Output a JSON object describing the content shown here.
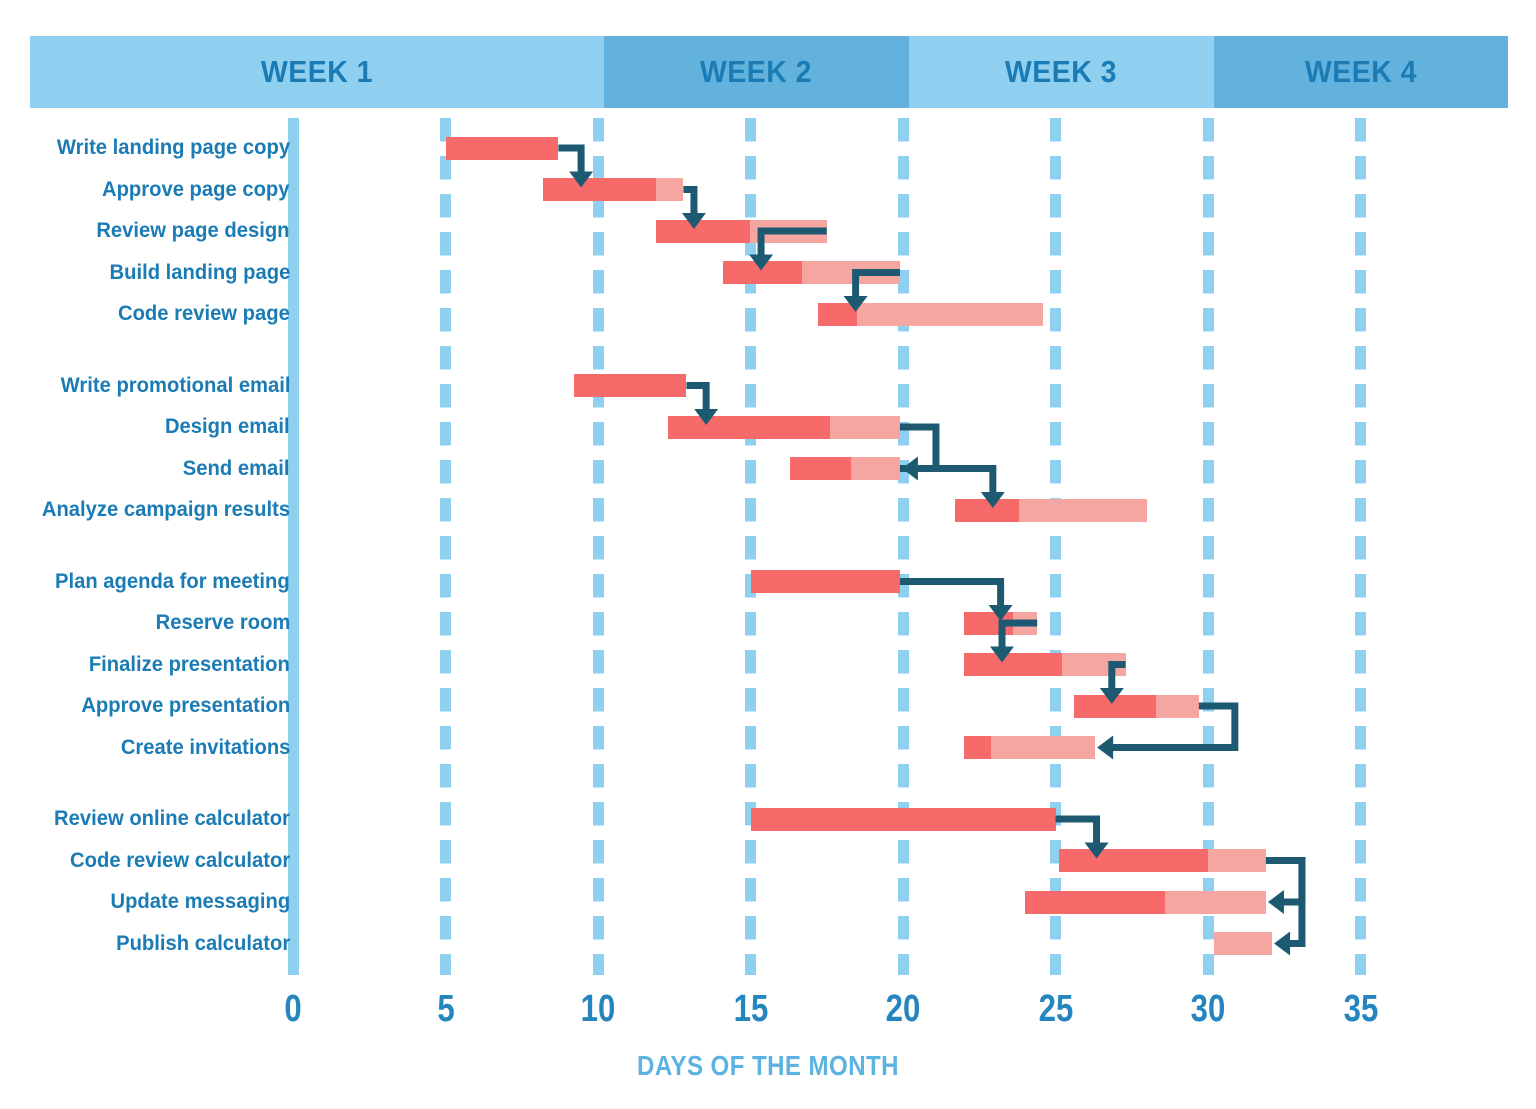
{
  "chart_data": {
    "type": "bar",
    "subtype": "gantt",
    "title": "",
    "xlabel": "DAYS OF THE MONTH",
    "ylabel": "",
    "xlim": [
      0,
      36.5
    ],
    "xticks": [
      0,
      5,
      10,
      15,
      20,
      25,
      30,
      35
    ],
    "xtick_labels": [
      "0",
      "5",
      "10",
      "15",
      "20",
      "25",
      "30",
      "35"
    ],
    "grid": true,
    "legend": "none",
    "colors": {
      "bar_dark": "#f76a6a",
      "bar_light": "#f6a6a1",
      "connector": "#1d5a72",
      "grid": "#8fd0f0",
      "week_light": "#8fd0f0",
      "week_dark": "#63b2de",
      "label_text": "#1b7cb5",
      "tick_text": "#2585bf",
      "axis_title": "#5cb3e0"
    },
    "weeks": [
      {
        "label": "WEEK 1",
        "start": 0,
        "end": 10,
        "shade": "light"
      },
      {
        "label": "WEEK 2",
        "start": 10,
        "end": 20,
        "shade": "dark"
      },
      {
        "label": "WEEK 3",
        "start": 20,
        "end": 30,
        "shade": "light"
      },
      {
        "label": "WEEK 4",
        "start": 30,
        "end": 40,
        "shade": "dark"
      }
    ],
    "groups": [
      {
        "name": "landing-page",
        "tasks": [
          {
            "label": "Write landing page copy",
            "start": 5.0,
            "dark_end": 8.7,
            "end": 8.7
          },
          {
            "label": "Approve page copy",
            "start": 8.2,
            "dark_end": 11.9,
            "end": 12.8
          },
          {
            "label": "Review page design",
            "start": 11.9,
            "dark_end": 15.0,
            "end": 17.5
          },
          {
            "label": "Build landing page",
            "start": 14.1,
            "dark_end": 16.7,
            "end": 19.9
          },
          {
            "label": "Code review page",
            "start": 17.2,
            "dark_end": 18.5,
            "end": 24.6
          }
        ]
      },
      {
        "name": "email-campaign",
        "tasks": [
          {
            "label": "Write promotional email",
            "start": 9.2,
            "dark_end": 12.9,
            "end": 12.9
          },
          {
            "label": "Design email",
            "start": 12.3,
            "dark_end": 17.6,
            "end": 19.9
          },
          {
            "label": "Send email",
            "start": 16.3,
            "dark_end": 18.3,
            "end": 19.9
          },
          {
            "label": "Analyze campaign results",
            "start": 21.7,
            "dark_end": 23.8,
            "end": 28.0
          }
        ]
      },
      {
        "name": "meeting",
        "tasks": [
          {
            "label": "Plan agenda for meeting",
            "start": 15.0,
            "dark_end": 19.9,
            "end": 19.9
          },
          {
            "label": "Reserve room",
            "start": 22.0,
            "dark_end": 23.6,
            "end": 24.4
          },
          {
            "label": "Finalize presentation",
            "start": 22.0,
            "dark_end": 25.2,
            "end": 27.3
          },
          {
            "label": "Approve presentation",
            "start": 25.6,
            "dark_end": 28.3,
            "end": 29.7
          },
          {
            "label": "Create invitations",
            "start": 22.0,
            "dark_end": 22.9,
            "end": 26.3
          }
        ]
      },
      {
        "name": "calculator",
        "tasks": [
          {
            "label": "Review online calculator",
            "start": 15.0,
            "dark_end": 25.0,
            "end": 25.0
          },
          {
            "label": "Code review calculator",
            "start": 25.1,
            "dark_end": 30.0,
            "end": 31.9
          },
          {
            "label": "Update messaging",
            "start": 24.0,
            "dark_end": 28.6,
            "end": 31.9
          },
          {
            "label": "Publish calculator",
            "start": 30.2,
            "dark_end": 30.2,
            "end": 32.1
          }
        ]
      }
    ],
    "dependencies": [
      {
        "from": "Write landing page copy",
        "to": "Approve page copy",
        "direction": "down"
      },
      {
        "from": "Approve page copy",
        "to": "Review page design",
        "direction": "down"
      },
      {
        "from": "Review page design",
        "to": "Build landing page",
        "direction": "down"
      },
      {
        "from": "Build landing page",
        "to": "Code review page",
        "direction": "down"
      },
      {
        "from": "Write promotional email",
        "to": "Design email",
        "direction": "down"
      },
      {
        "from": "Design email",
        "to": "Send email",
        "direction": "left"
      },
      {
        "from": "Send email",
        "to": "Analyze campaign results",
        "direction": "down"
      },
      {
        "from": "Plan agenda for meeting",
        "to": "Reserve room",
        "direction": "down"
      },
      {
        "from": "Reserve room",
        "to": "Finalize presentation",
        "direction": "down"
      },
      {
        "from": "Finalize presentation",
        "to": "Approve presentation",
        "direction": "down"
      },
      {
        "from": "Approve presentation",
        "to": "Create invitations",
        "direction": "left"
      },
      {
        "from": "Review online calculator",
        "to": "Code review calculator",
        "direction": "down"
      },
      {
        "from": "Code review calculator",
        "to": "Update messaging",
        "direction": "left"
      },
      {
        "from": "Code review calculator",
        "to": "Publish calculator",
        "direction": "left"
      }
    ]
  }
}
